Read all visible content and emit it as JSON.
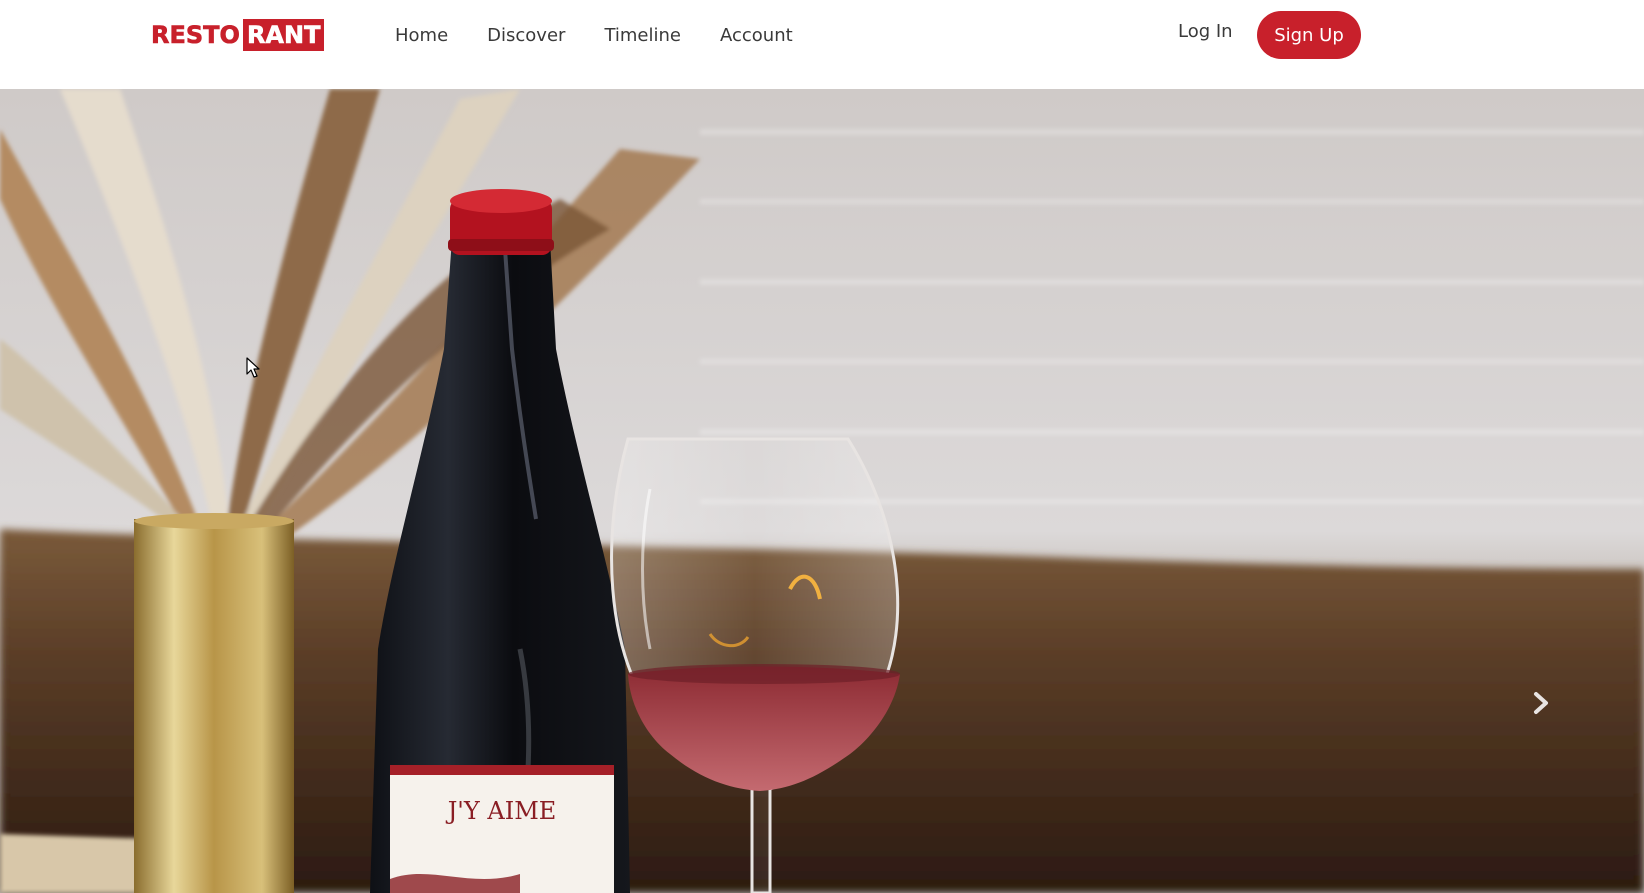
{
  "brand": {
    "part1": "RESTO",
    "part2": "RANT",
    "color": "#c8202b"
  },
  "nav": {
    "links": [
      "Home",
      "Discover",
      "Timeline",
      "Account"
    ]
  },
  "auth": {
    "login": "Log In",
    "signup": "Sign Up"
  },
  "hero": {
    "bottle_label": "J'Y AIME",
    "next_icon": "chevron-right-icon"
  }
}
